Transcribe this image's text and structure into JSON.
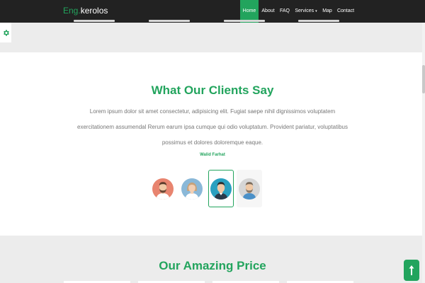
{
  "navbar": {
    "brand_prefix": "Eng.",
    "brand_name": "kerolos",
    "items": [
      {
        "label": "Home",
        "active": true
      },
      {
        "label": "About",
        "active": false
      },
      {
        "label": "FAQ",
        "active": false
      },
      {
        "label": "Services",
        "active": false,
        "has_dropdown": true
      },
      {
        "label": "Map",
        "active": false
      },
      {
        "label": "Contact",
        "active": false
      }
    ],
    "dropdown_caret": "▾"
  },
  "settings": {
    "icon": "gear-icon"
  },
  "testimonials": {
    "title": "What Our Clients Say",
    "quote": "Lorem ipsum dolor sit amet consectetur, adipisicing elit. Fugiat saepe nihil dignissimos voluptatem exercitationem assumendal Rerum earum ipsa cumque qui odio voluptatum. Provident pariatur, voluptatibus possimus et dolores doloremque eaque.",
    "author": "Walid Farhat",
    "avatars": [
      {
        "icon": "avatar-man-beard-icon",
        "selected": false
      },
      {
        "icon": "avatar-woman-icon",
        "selected": false
      },
      {
        "icon": "avatar-man-icon",
        "selected": true
      },
      {
        "icon": "avatar-man-grey-beard-icon",
        "selected": false
      }
    ]
  },
  "pricing": {
    "title": "Our Amazing Price"
  },
  "scroll_top": {
    "icon": "arrow-up-icon"
  },
  "colors": {
    "accent": "#22a45d",
    "navbar_bg": "#222222",
    "page_bg": "#ececec",
    "section_bg": "#ffffff",
    "body_text": "#777777"
  }
}
